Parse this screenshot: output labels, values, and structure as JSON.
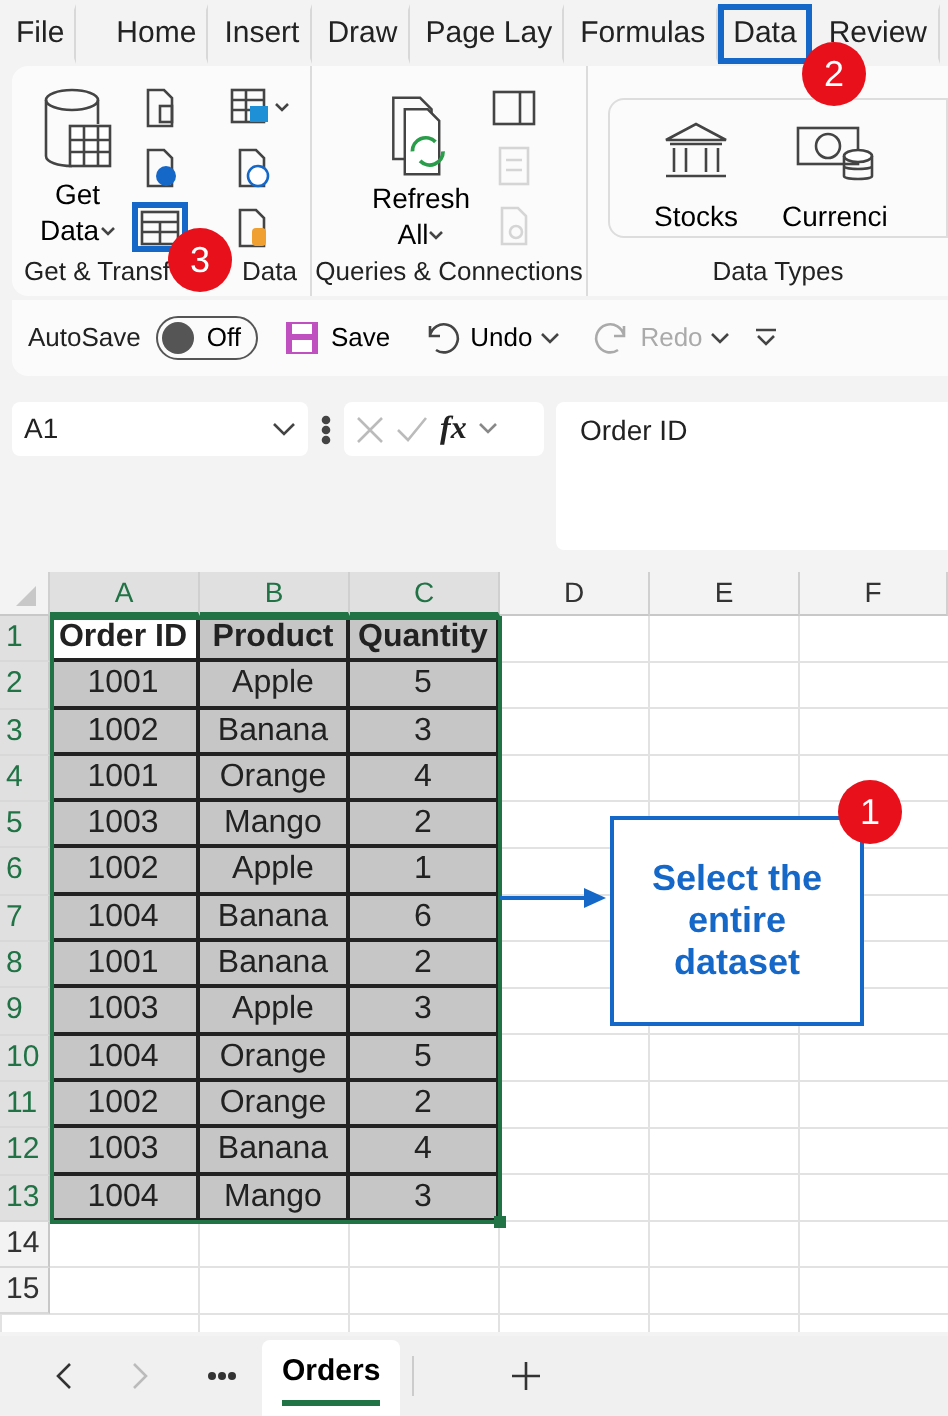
{
  "ribbon_tabs": [
    {
      "label": "File",
      "selected": false
    },
    {
      "label": "Home",
      "selected": false
    },
    {
      "label": "Insert",
      "selected": false
    },
    {
      "label": "Draw",
      "selected": false
    },
    {
      "label": "Page Lay",
      "selected": false
    },
    {
      "label": "Formulas",
      "selected": false
    },
    {
      "label": "Data",
      "selected": true
    },
    {
      "label": "Review",
      "selected": false
    }
  ],
  "ribbon_groups": [
    {
      "kind": "get",
      "label_start": "Get & Transf",
      "label_end": "Data",
      "big_button": {
        "line1": "Get",
        "line2": "Data"
      },
      "small_buttons": [
        {
          "kind": "doc-text",
          "disabled": false,
          "highlighted": false
        },
        {
          "kind": "doc-globe",
          "disabled": false,
          "highlighted": false
        },
        {
          "kind": "table",
          "disabled": false,
          "highlighted": true
        },
        {
          "kind": "table-camera",
          "disabled": false,
          "highlighted": false
        },
        {
          "kind": "doc-clock",
          "disabled": false,
          "highlighted": false
        },
        {
          "kind": "doc-db",
          "disabled": false,
          "highlighted": false
        }
      ]
    },
    {
      "kind": "queries",
      "label": "Queries & Connections",
      "big_button": {
        "line1": "Refresh",
        "line2": "All"
      },
      "small_buttons": [
        {
          "kind": "panel",
          "disabled": false,
          "highlighted": false
        },
        {
          "kind": "props",
          "disabled": true,
          "highlighted": false
        },
        {
          "kind": "doc-link",
          "disabled": true,
          "highlighted": false
        }
      ]
    },
    {
      "kind": "types",
      "label": "Data Types",
      "types": [
        {
          "kind": "bank",
          "label": "Stocks"
        },
        {
          "kind": "money",
          "label": "Currenci"
        }
      ]
    }
  ],
  "quick_access": {
    "autosave_label": "AutoSave",
    "autosave": {
      "on": false,
      "label": "Off"
    },
    "buttons": [
      {
        "kind": "save",
        "label": "Save",
        "disabled": false
      },
      {
        "kind": "undo",
        "label": "Undo",
        "disabled": false
      },
      {
        "kind": "redo",
        "label": "Redo",
        "disabled": true
      }
    ]
  },
  "formula_bar": {
    "name_box": "A1",
    "function_label": "fx",
    "formula": "Order ID"
  },
  "sheet": {
    "columns": [
      {
        "label": "A",
        "selected": true
      },
      {
        "label": "B",
        "selected": true
      },
      {
        "label": "C",
        "selected": true
      },
      {
        "label": "D",
        "selected": false
      },
      {
        "label": "E",
        "selected": false
      },
      {
        "label": "F",
        "selected": false
      }
    ],
    "rows": [
      {
        "number": "1",
        "selected": true,
        "kind": "header",
        "cells": [
          "Order ID",
          "Product",
          "Quantity"
        ]
      },
      {
        "number": "2",
        "selected": true,
        "kind": "data",
        "cells": [
          "1001",
          "Apple",
          "5"
        ]
      },
      {
        "number": "3",
        "selected": true,
        "kind": "data",
        "cells": [
          "1002",
          "Banana",
          "3"
        ]
      },
      {
        "number": "4",
        "selected": true,
        "kind": "data",
        "cells": [
          "1001",
          "Orange",
          "4"
        ]
      },
      {
        "number": "5",
        "selected": true,
        "kind": "data",
        "cells": [
          "1003",
          "Mango",
          "2"
        ]
      },
      {
        "number": "6",
        "selected": true,
        "kind": "data",
        "cells": [
          "1002",
          "Apple",
          "1"
        ]
      },
      {
        "number": "7",
        "selected": true,
        "kind": "data",
        "cells": [
          "1004",
          "Banana",
          "6"
        ]
      },
      {
        "number": "8",
        "selected": true,
        "kind": "data",
        "cells": [
          "1001",
          "Banana",
          "2"
        ]
      },
      {
        "number": "9",
        "selected": true,
        "kind": "data",
        "cells": [
          "1003",
          "Apple",
          "3"
        ]
      },
      {
        "number": "10",
        "selected": true,
        "kind": "data",
        "cells": [
          "1004",
          "Orange",
          "5"
        ]
      },
      {
        "number": "11",
        "selected": true,
        "kind": "data",
        "cells": [
          "1002",
          "Orange",
          "2"
        ]
      },
      {
        "number": "12",
        "selected": true,
        "kind": "data",
        "cells": [
          "1003",
          "Banana",
          "4"
        ]
      },
      {
        "number": "13",
        "selected": true,
        "kind": "data",
        "cells": [
          "1004",
          "Mango",
          "3"
        ]
      },
      {
        "number": "14",
        "selected": false,
        "kind": "data",
        "cells": []
      },
      {
        "number": "15",
        "selected": false,
        "kind": "data",
        "cells": []
      }
    ]
  },
  "callout": {
    "text": "Select the entire dataset",
    "badge": "1"
  },
  "step_badges": [
    {
      "kind": "tab",
      "number": "2"
    },
    {
      "kind": "ribbon",
      "number": "3"
    }
  ],
  "sheet_tabs": [
    {
      "label": "Orders",
      "selected": true
    }
  ]
}
